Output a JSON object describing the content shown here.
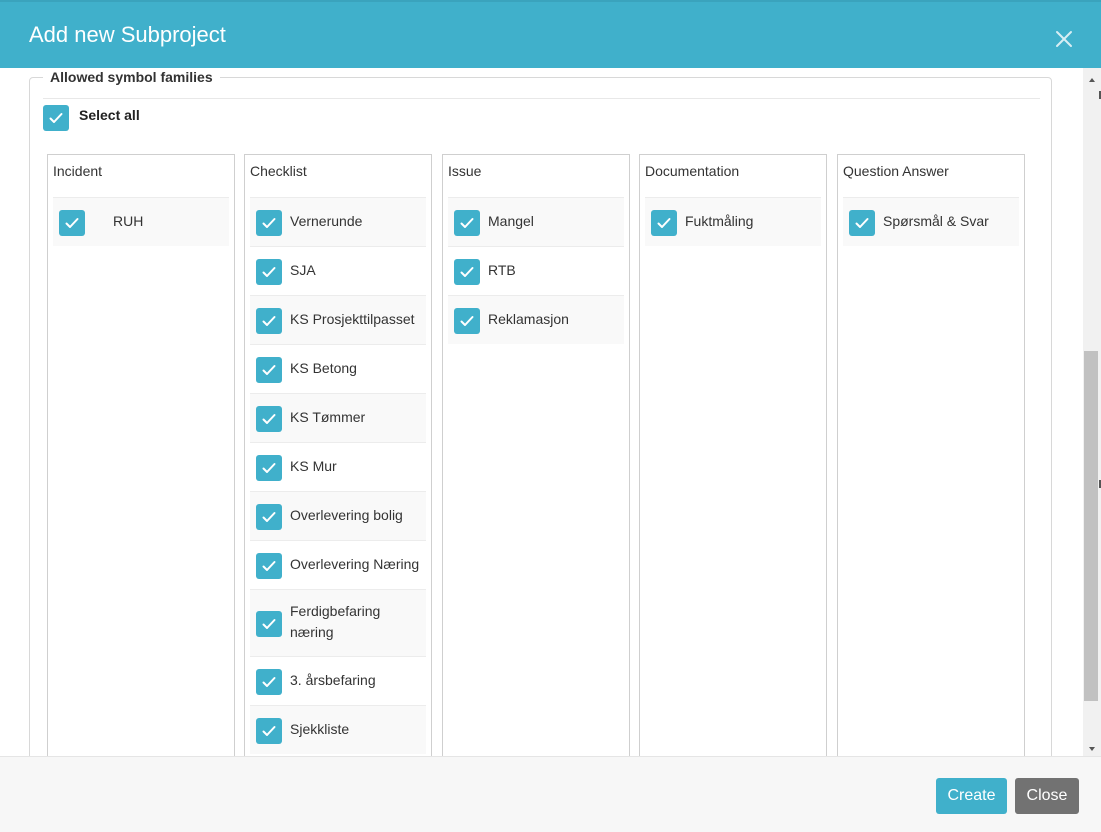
{
  "dialog": {
    "title": "Add new Subproject"
  },
  "section": {
    "legend": "Allowed symbol families",
    "select_all_label": "Select all",
    "select_all_checked": true
  },
  "columns": [
    {
      "title": "Incident",
      "items": [
        {
          "label": "RUH",
          "checked": true
        }
      ]
    },
    {
      "title": "Checklist",
      "items": [
        {
          "label": "Vernerunde",
          "checked": true
        },
        {
          "label": "SJA",
          "checked": true
        },
        {
          "label": "KS Prosjekttilpasset",
          "checked": true
        },
        {
          "label": "KS Betong",
          "checked": true
        },
        {
          "label": "KS Tømmer",
          "checked": true
        },
        {
          "label": "KS Mur",
          "checked": true
        },
        {
          "label": "Overlevering bolig",
          "checked": true
        },
        {
          "label": "Overlevering Næring",
          "checked": true
        },
        {
          "label": "Ferdigbefaring næring",
          "checked": true
        },
        {
          "label": "3. årsbefaring",
          "checked": true
        },
        {
          "label": "Sjekkliste",
          "checked": true
        }
      ]
    },
    {
      "title": "Issue",
      "items": [
        {
          "label": "Mangel",
          "checked": true
        },
        {
          "label": "RTB",
          "checked": true
        },
        {
          "label": "Reklamasjon",
          "checked": true
        }
      ]
    },
    {
      "title": "Documentation",
      "items": [
        {
          "label": "Fuktmåling",
          "checked": true
        }
      ]
    },
    {
      "title": "Question Answer",
      "items": [
        {
          "label": "Spørsmål & Svar",
          "checked": true
        }
      ]
    }
  ],
  "footer": {
    "create_label": "Create",
    "close_label": "Close"
  },
  "colors": {
    "accent": "#40b0cb",
    "close_button": "#727272"
  },
  "icons": {
    "close": "close-icon",
    "check": "checkmark-icon",
    "scroll_up": "scroll-up-arrow-icon",
    "scroll_down": "scroll-down-arrow-icon"
  }
}
